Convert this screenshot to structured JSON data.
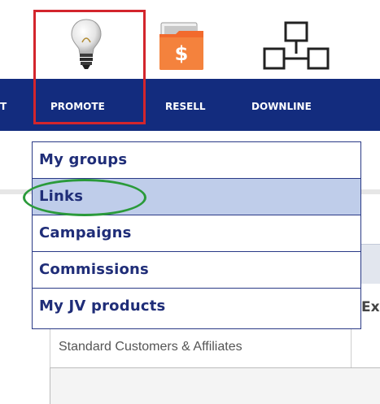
{
  "nav": {
    "partial_label": "T",
    "items": [
      {
        "label": "PROMOTE"
      },
      {
        "label": "RESELL"
      },
      {
        "label": "DOWNLINE"
      }
    ]
  },
  "dropdown": {
    "items": [
      {
        "label": "My groups"
      },
      {
        "label": "Links",
        "active": true
      },
      {
        "label": "Campaigns"
      },
      {
        "label": "Commissions"
      },
      {
        "label": "My JV products"
      }
    ]
  },
  "background": {
    "partial_text": "Ex",
    "tab_label": "Standard Customers & Affiliates"
  },
  "icons": [
    "lightbulb-icon",
    "dollar-folder-icon",
    "network-icon"
  ],
  "colors": {
    "nav_background": "#132c7e",
    "highlight_red": "#d3252c",
    "circle_green": "#2a9a3a",
    "active_item": "#bfcdea"
  }
}
